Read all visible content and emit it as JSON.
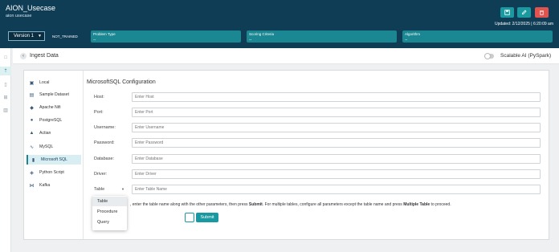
{
  "header": {
    "app_title": "AION_Usecase",
    "app_subtitle": "aion usecase",
    "updated": "Updated: 2/12/2025 | 6:20:09 am",
    "version_label": "Version  1",
    "status": "NOT_TRAINED",
    "info_cards": [
      {
        "label": "Problem Type",
        "value": "--"
      },
      {
        "label": "Scoring Criteria",
        "value": "--"
      },
      {
        "label": "Algorithm",
        "value": "--"
      }
    ],
    "buttons": [
      "save-icon",
      "edit-icon",
      "delete-icon"
    ]
  },
  "rail": {
    "icons": [
      "home-icon",
      "upload-icon",
      "file-icon",
      "settings-icon",
      "trash-icon"
    ]
  },
  "page": {
    "back": "‹",
    "title": "Ingest Data",
    "toggle_label": "Scalable AI (PySpark)",
    "toggle_on": false
  },
  "sources": {
    "items": [
      {
        "label": "Local",
        "icon": "folder-icon"
      },
      {
        "label": "Sample Dataset",
        "icon": "dataset-icon"
      },
      {
        "label": "Apache Nifi",
        "icon": "nifi-icon"
      },
      {
        "label": "PostgreSQL",
        "icon": "postgres-icon"
      },
      {
        "label": "Actian",
        "icon": "actian-icon"
      },
      {
        "label": "MySQL",
        "icon": "mysql-icon"
      },
      {
        "label": "Microsoft SQL",
        "icon": "mssql-icon"
      },
      {
        "label": "Python Script",
        "icon": "python-icon"
      },
      {
        "label": "Kafka",
        "icon": "kafka-icon"
      }
    ],
    "selected": "Microsoft SQL"
  },
  "form": {
    "title": "MicrosoftSQL Configuration",
    "fields": [
      {
        "label": "Host:",
        "placeholder": "Enter Host"
      },
      {
        "label": "Port:",
        "placeholder": "Enter Port"
      },
      {
        "label": "Username:",
        "placeholder": "Enter Username"
      },
      {
        "label": "Password:",
        "placeholder": "Enter Password"
      },
      {
        "label": "Database:",
        "placeholder": "Enter Database"
      },
      {
        "label": "Driver:",
        "placeholder": "Enter Driver"
      }
    ],
    "table_select": {
      "label": "Table",
      "placeholder": "Enter Table Name"
    },
    "note_pre": ", enter the table name along with the other parameters, then press ",
    "note_b1": "Submit",
    "note_mid": ". For multiple tables, configure all parameters except the table name and press ",
    "note_b2": "Multiple Table",
    "note_post": " to proceed.",
    "submit_label": "Submit"
  },
  "dropdown": {
    "options": [
      "Table",
      "Procedure",
      "Query"
    ],
    "selected": "Table"
  },
  "colors": {
    "header": "#0f3d55",
    "accent": "#1a9aa0",
    "danger": "#e0534f"
  }
}
